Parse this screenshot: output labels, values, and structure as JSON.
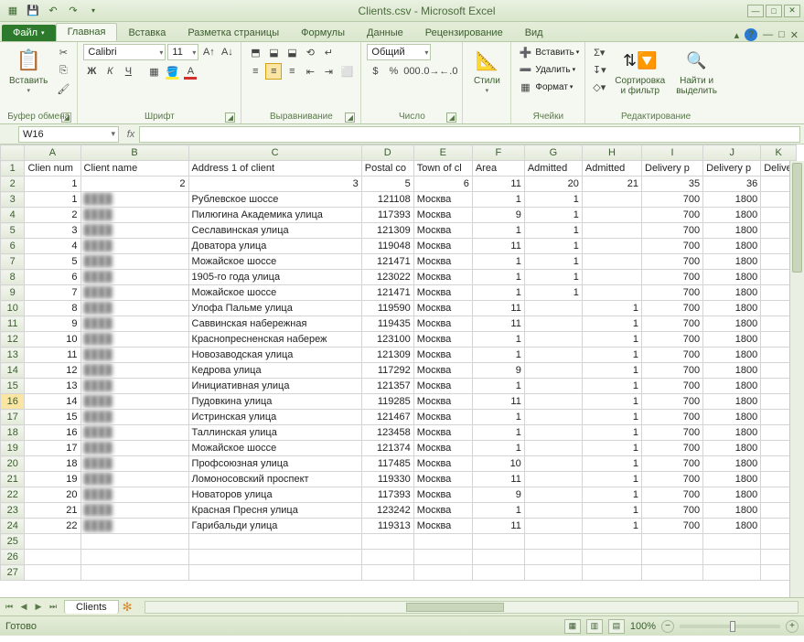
{
  "app_title": "Clients.csv  -  Microsoft Excel",
  "tabs": {
    "file": "Файл",
    "home": "Главная",
    "insert": "Вставка",
    "layout": "Разметка страницы",
    "formulas": "Формулы",
    "data": "Данные",
    "review": "Рецензирование",
    "view": "Вид"
  },
  "ribbon": {
    "clipboard": {
      "paste": "Вставить",
      "label": "Буфер обмена"
    },
    "font": {
      "name": "Calibri",
      "size": "11",
      "label": "Шрифт",
      "bold": "Ж",
      "italic": "К",
      "underline": "Ч"
    },
    "align": {
      "label": "Выравнивание"
    },
    "number": {
      "format": "Общий",
      "label": "Число"
    },
    "styles": {
      "styles": "Стили",
      "label": ""
    },
    "cells": {
      "insert": "Вставить",
      "delete": "Удалить",
      "format": "Формат",
      "label": "Ячейки"
    },
    "editing": {
      "sort": "Сортировка\nи фильтр",
      "find": "Найти и\nвыделить",
      "label": "Редактирование"
    }
  },
  "namebox": "W16",
  "columns": [
    {
      "letter": "",
      "w": 26
    },
    {
      "letter": "A",
      "w": 60
    },
    {
      "letter": "B",
      "w": 116
    },
    {
      "letter": "C",
      "w": 186
    },
    {
      "letter": "D",
      "w": 56
    },
    {
      "letter": "E",
      "w": 63
    },
    {
      "letter": "F",
      "w": 56
    },
    {
      "letter": "G",
      "w": 62
    },
    {
      "letter": "H",
      "w": 64
    },
    {
      "letter": "I",
      "w": 66
    },
    {
      "letter": "J",
      "w": 62
    },
    {
      "letter": "K",
      "w": 38
    }
  ],
  "headers_row": [
    "Clien num",
    "Client name",
    "Address 1 of client",
    "Postal co",
    "Town of cl",
    "Area",
    "Admitted",
    "Admitted",
    "Delivery p",
    "Delivery p",
    "Delive"
  ],
  "numbers_row": [
    "1",
    "2",
    "3",
    "5",
    "6",
    "11",
    "20",
    "21",
    "35",
    "36",
    ""
  ],
  "data_rows": [
    {
      "n": "1",
      "name": "████",
      "addr": "Рублевское шоссе",
      "post": "121108",
      "town": "Москва",
      "area": "1",
      "a1": "1",
      "a2": "",
      "d1": "700",
      "d2": "1800",
      "d3": ""
    },
    {
      "n": "2",
      "name": "████",
      "addr": "Пилюгина Академика улица",
      "post": "117393",
      "town": "Москва",
      "area": "9",
      "a1": "1",
      "a2": "",
      "d1": "700",
      "d2": "1800",
      "d3": ""
    },
    {
      "n": "3",
      "name": "████",
      "addr": "Сеславинская улица",
      "post": "121309",
      "town": "Москва",
      "area": "1",
      "a1": "1",
      "a2": "",
      "d1": "700",
      "d2": "1800",
      "d3": ""
    },
    {
      "n": "4",
      "name": "████",
      "addr": "Доватора улица",
      "post": "119048",
      "town": "Москва",
      "area": "11",
      "a1": "1",
      "a2": "",
      "d1": "700",
      "d2": "1800",
      "d3": ""
    },
    {
      "n": "5",
      "name": "████",
      "addr": "Можайское шоссе",
      "post": "121471",
      "town": "Москва",
      "area": "1",
      "a1": "1",
      "a2": "",
      "d1": "700",
      "d2": "1800",
      "d3": ""
    },
    {
      "n": "6",
      "name": "████",
      "addr": "1905-го года улица",
      "post": "123022",
      "town": "Москва",
      "area": "1",
      "a1": "1",
      "a2": "",
      "d1": "700",
      "d2": "1800",
      "d3": ""
    },
    {
      "n": "7",
      "name": "████",
      "addr": "Можайское шоссе",
      "post": "121471",
      "town": "Москва",
      "area": "1",
      "a1": "1",
      "a2": "",
      "d1": "700",
      "d2": "1800",
      "d3": ""
    },
    {
      "n": "8",
      "name": "████",
      "addr": "Улофа Пальме улица",
      "post": "119590",
      "town": "Москва",
      "area": "11",
      "a1": "",
      "a2": "1",
      "d1": "700",
      "d2": "1800",
      "d3": ""
    },
    {
      "n": "9",
      "name": "████",
      "addr": "Саввинская набережная",
      "post": "119435",
      "town": "Москва",
      "area": "11",
      "a1": "",
      "a2": "1",
      "d1": "700",
      "d2": "1800",
      "d3": ""
    },
    {
      "n": "10",
      "name": "████",
      "addr": "Краснопресненская набереж",
      "post": "123100",
      "town": "Москва",
      "area": "1",
      "a1": "",
      "a2": "1",
      "d1": "700",
      "d2": "1800",
      "d3": ""
    },
    {
      "n": "11",
      "name": "████",
      "addr": "Новозаводская улица",
      "post": "121309",
      "town": "Москва",
      "area": "1",
      "a1": "",
      "a2": "1",
      "d1": "700",
      "d2": "1800",
      "d3": ""
    },
    {
      "n": "12",
      "name": "████",
      "addr": "Кедрова улица",
      "post": "117292",
      "town": "Москва",
      "area": "9",
      "a1": "",
      "a2": "1",
      "d1": "700",
      "d2": "1800",
      "d3": ""
    },
    {
      "n": "13",
      "name": "████",
      "addr": "Инициативная улица",
      "post": "121357",
      "town": "Москва",
      "area": "1",
      "a1": "",
      "a2": "1",
      "d1": "700",
      "d2": "1800",
      "d3": ""
    },
    {
      "n": "14",
      "name": "████",
      "addr": "Пудовкина улица",
      "post": "119285",
      "town": "Москва",
      "area": "11",
      "a1": "",
      "a2": "1",
      "d1": "700",
      "d2": "1800",
      "d3": ""
    },
    {
      "n": "15",
      "name": "████",
      "addr": "Истринская улица",
      "post": "121467",
      "town": "Москва",
      "area": "1",
      "a1": "",
      "a2": "1",
      "d1": "700",
      "d2": "1800",
      "d3": ""
    },
    {
      "n": "16",
      "name": "████",
      "addr": "Таллинская улица",
      "post": "123458",
      "town": "Москва",
      "area": "1",
      "a1": "",
      "a2": "1",
      "d1": "700",
      "d2": "1800",
      "d3": ""
    },
    {
      "n": "17",
      "name": "████",
      "addr": "Можайское шоссе",
      "post": "121374",
      "town": "Москва",
      "area": "1",
      "a1": "",
      "a2": "1",
      "d1": "700",
      "d2": "1800",
      "d3": ""
    },
    {
      "n": "18",
      "name": "████",
      "addr": "Профсоюзная улица",
      "post": "117485",
      "town": "Москва",
      "area": "10",
      "a1": "",
      "a2": "1",
      "d1": "700",
      "d2": "1800",
      "d3": ""
    },
    {
      "n": "19",
      "name": "████",
      "addr": "Ломоносовский проспект",
      "post": "119330",
      "town": "Москва",
      "area": "11",
      "a1": "",
      "a2": "1",
      "d1": "700",
      "d2": "1800",
      "d3": ""
    },
    {
      "n": "20",
      "name": "████",
      "addr": "Новаторов улица",
      "post": "117393",
      "town": "Москва",
      "area": "9",
      "a1": "",
      "a2": "1",
      "d1": "700",
      "d2": "1800",
      "d3": ""
    },
    {
      "n": "21",
      "name": "████",
      "addr": "Красная Пресня улица",
      "post": "123242",
      "town": "Москва",
      "area": "1",
      "a1": "",
      "a2": "1",
      "d1": "700",
      "d2": "1800",
      "d3": ""
    },
    {
      "n": "22",
      "name": "████",
      "addr": "Гарибальди улица",
      "post": "119313",
      "town": "Москва",
      "area": "11",
      "a1": "",
      "a2": "1",
      "d1": "700",
      "d2": "1800",
      "d3": ""
    }
  ],
  "active_row_index": 14,
  "sheet_tab": "Clients",
  "status": {
    "ready": "Готово",
    "zoom": "100%"
  }
}
